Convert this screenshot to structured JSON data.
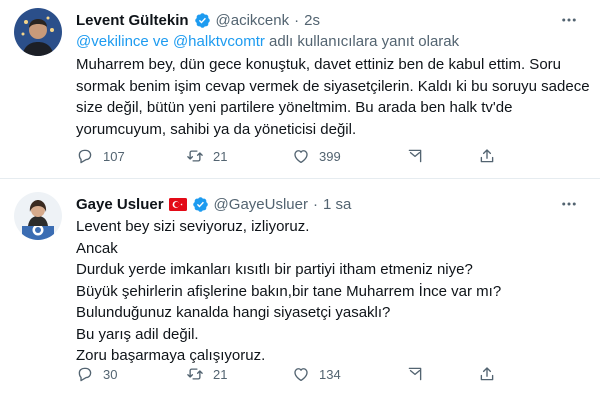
{
  "colors": {
    "link": "#1d9bf0",
    "verified": "#1d9bf0",
    "muted": "#536471",
    "text": "#0f1419"
  },
  "tweets": [
    {
      "author": "Levent Gültekin",
      "verified": true,
      "handle": "@acikcenk",
      "separator": "·",
      "time": "2s",
      "reply_to": {
        "mention_1": "@vekilince",
        "joiner": " ve ",
        "mention_2": "@halktvcomtr",
        "suffix": " adlı kullanıcılara yanıt olarak"
      },
      "text": "Muharrem bey, dün gece konuştuk, davet ettiniz ben de kabul ettim. Soru sormak benim işim cevap vermek de siyasetçilerin. Kaldı ki bu soruyu sadece size değil, bütün yeni partilere yöneltmim. Bu arada ben halk tv'de yorumcuyum, sahibi ya da yöneticisi değil.",
      "stats": {
        "replies": "107",
        "retweets": "21",
        "likes": "399"
      },
      "icons": [
        "reply-icon",
        "retweet-icon",
        "like-icon",
        "share-icon",
        "upload-icon",
        "more-icon",
        "verified-badge-icon"
      ]
    },
    {
      "author": "Gaye Usluer",
      "verified": true,
      "flag": "turkey-flag-icon",
      "handle": "@GayeUsluer",
      "separator": "·",
      "time": "1 sa",
      "lines": [
        "Levent bey sizi seviyoruz, izliyoruz.",
        "Ancak",
        "Durduk yerde imkanları kısıtlı bir partiyi itham etmeniz niye?",
        "Büyük şehirlerin  afişlerine bakın,bir tane Muharrem İnce var mı?",
        "Bulunduğunuz kanalda hangi siyasetçi yasaklı?",
        "Bu yarış adil değil.",
        "Zoru başarmaya çalışıyoruz."
      ],
      "stats": {
        "replies": "30",
        "retweets": "21",
        "likes": "134"
      },
      "icons": [
        "reply-icon",
        "retweet-icon",
        "like-icon",
        "share-icon",
        "upload-icon",
        "more-icon",
        "verified-badge-icon"
      ]
    }
  ]
}
